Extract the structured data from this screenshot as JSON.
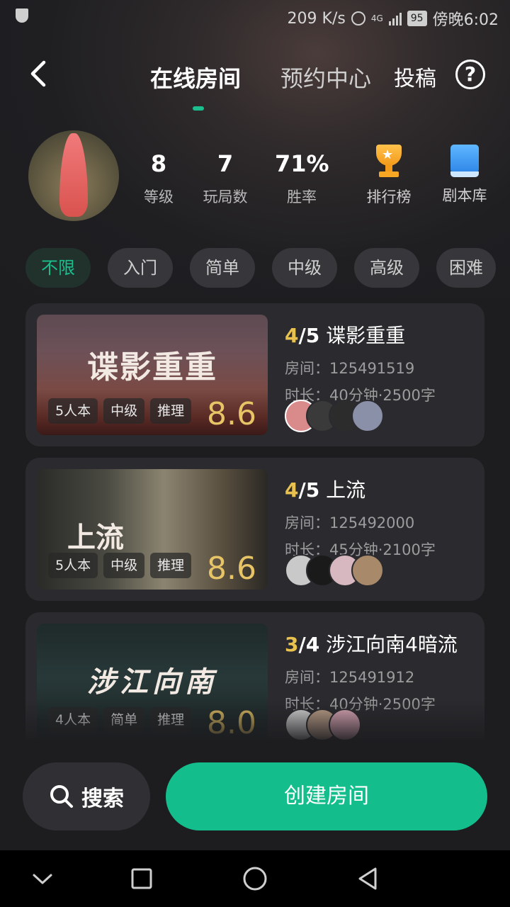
{
  "status_bar": {
    "speed": "209 K/s",
    "network": "4G",
    "battery": "95",
    "time": "傍晚6:02"
  },
  "header": {
    "tabs": [
      {
        "label": "在线房间",
        "active": true
      },
      {
        "label": "预约中心",
        "active": false
      }
    ],
    "submit_label": "投稿",
    "help_label": "?"
  },
  "profile": {
    "stats": [
      {
        "value": "8",
        "label": "等级"
      },
      {
        "value": "7",
        "label": "玩局数"
      },
      {
        "value": "71%",
        "label": "胜率"
      }
    ],
    "ranking_label": "排行榜",
    "library_label": "剧本库"
  },
  "filters": [
    {
      "label": "不限",
      "active": true
    },
    {
      "label": "入门",
      "active": false
    },
    {
      "label": "简单",
      "active": false
    },
    {
      "label": "中级",
      "active": false
    },
    {
      "label": "高级",
      "active": false
    },
    {
      "label": "困难",
      "active": false
    }
  ],
  "rooms": [
    {
      "current": "4",
      "capacity": "/5",
      "title": "谍影重重",
      "cover_title": "谍影重重",
      "room_line": "房间：125491519",
      "duration_line": "时长：40分钟·2500字",
      "tags": [
        "5人本",
        "中级",
        "推理"
      ],
      "score": "8.6",
      "player_colors": [
        "#d98a8a",
        "#3a3a3a",
        "#2c2c2c",
        "#8a90a8"
      ]
    },
    {
      "current": "4",
      "capacity": "/5",
      "title": "上流",
      "cover_title": "上流",
      "room_line": "房间：125492000",
      "duration_line": "时长：45分钟·2100字",
      "tags": [
        "5人本",
        "中级",
        "推理"
      ],
      "score": "8.6",
      "player_colors": [
        "#c9c9c9",
        "#1a1a1a",
        "#d8b8c0",
        "#a88a6a"
      ]
    },
    {
      "current": "3",
      "capacity": "/4",
      "title": "涉江向南4暗流",
      "cover_title": "涉江向南",
      "room_line": "房间：125491912",
      "duration_line": "时长：40分钟·2500字",
      "tags": [
        "4人本",
        "简单",
        "推理"
      ],
      "score": "8.0",
      "player_colors": [
        "#e0e0e0",
        "#c8a890",
        "#e8b0c0"
      ]
    }
  ],
  "actions": {
    "search_label": "搜索",
    "create_label": "创建房间"
  },
  "colors": {
    "accent": "#14be8c",
    "score": "#e7c466",
    "current_count": "#e9c14f",
    "background": "#1d1d20",
    "card": "#2b2b2f"
  }
}
